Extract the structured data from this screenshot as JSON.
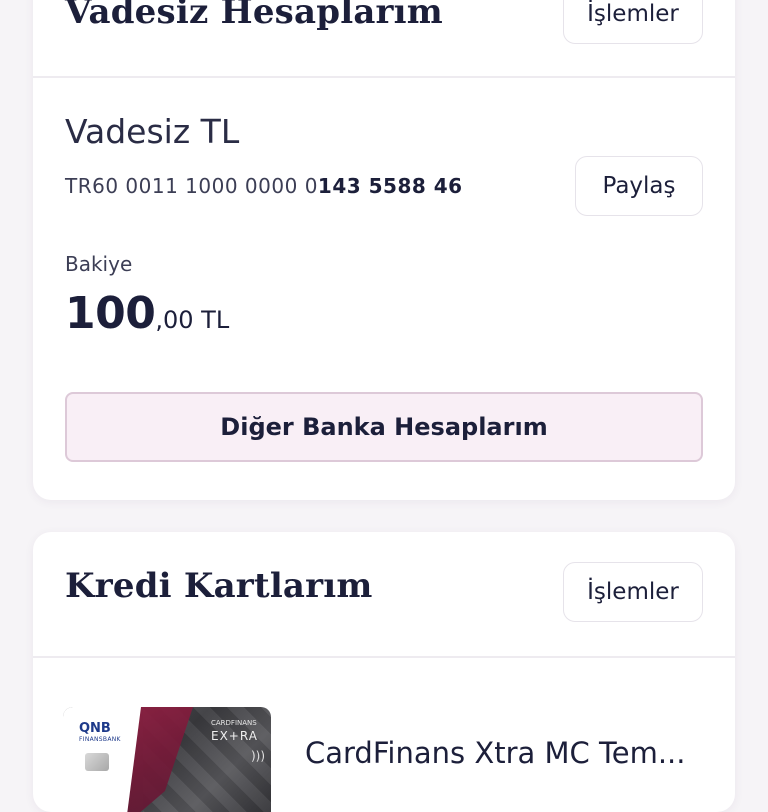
{
  "accounts_section": {
    "title": "Vadesiz Hesaplarım",
    "actions_label": "İşlemler",
    "account": {
      "name": "Vadesiz TL",
      "iban_prefix": "TR60 0011 1000 0000 0",
      "iban_suffix": "143 5588 46",
      "share_label": "Paylaş",
      "balance_label": "Bakiye",
      "balance_integer": "100",
      "balance_fraction": ",00 TL"
    },
    "other_banks_label": "Diğer Banka Hesaplarım"
  },
  "cards_section": {
    "title": "Kredi Kartlarım",
    "actions_label": "İşlemler",
    "card": {
      "name": "CardFinans Xtra MC Tem...",
      "image_logo": "QNB",
      "image_logo_sub": "FINANSBANK",
      "image_brand": "CARDFINANS",
      "image_extra": "EX+RA",
      "nfc_icon": "contactless-icon"
    }
  },
  "colors": {
    "background": "#f6f4f7",
    "text_dark": "#1c1f3a",
    "accent_button_bg": "#f9eff6",
    "accent_button_border": "#ddc9d8"
  }
}
